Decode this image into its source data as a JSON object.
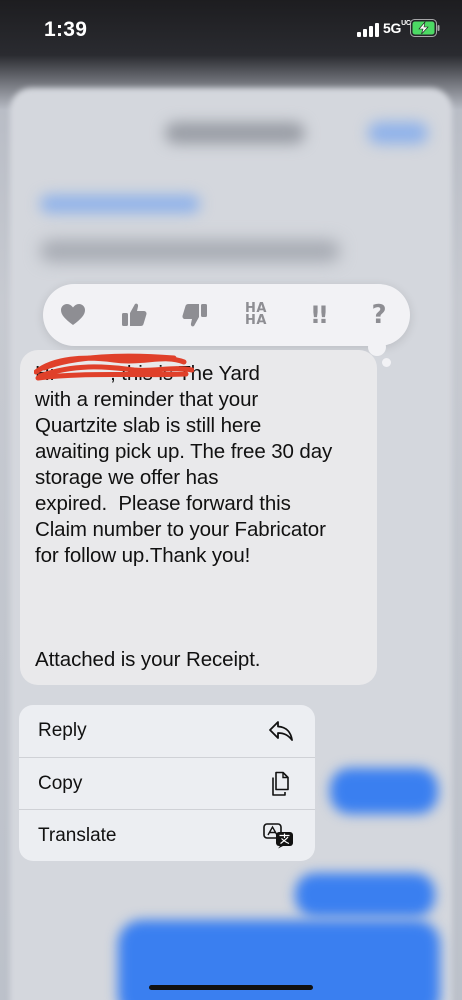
{
  "status_bar": {
    "time": "1:39",
    "network": "5G",
    "network_sup": "UC"
  },
  "tapback": {
    "reactions": [
      {
        "name": "heart-icon"
      },
      {
        "name": "thumbs-up-icon"
      },
      {
        "name": "thumbs-down-icon"
      },
      {
        "name": "haha-icon",
        "text": "HA HA"
      },
      {
        "name": "exclamation-icon",
        "text": "!!"
      },
      {
        "name": "question-icon",
        "text": "?"
      }
    ]
  },
  "message": {
    "text": "Hi          , this is The Yard\nwith a reminder that your\nQuartzite slab is still here\nawaiting pick up. The free 30 day\nstorage we offer has\nexpired.  Please forward this\nClaim number to your Fabricator\nfor follow up.Thank you!\n\n\n\nAttached is your Receipt."
  },
  "context_menu": {
    "items": [
      {
        "label": "Reply",
        "icon": "reply-icon"
      },
      {
        "label": "Copy",
        "icon": "copy-icon"
      },
      {
        "label": "Translate",
        "icon": "translate-icon"
      }
    ]
  },
  "colors": {
    "bubble": "#e9e9eb",
    "accent_blue": "#3a7ff0",
    "redaction": "#e0402a"
  }
}
